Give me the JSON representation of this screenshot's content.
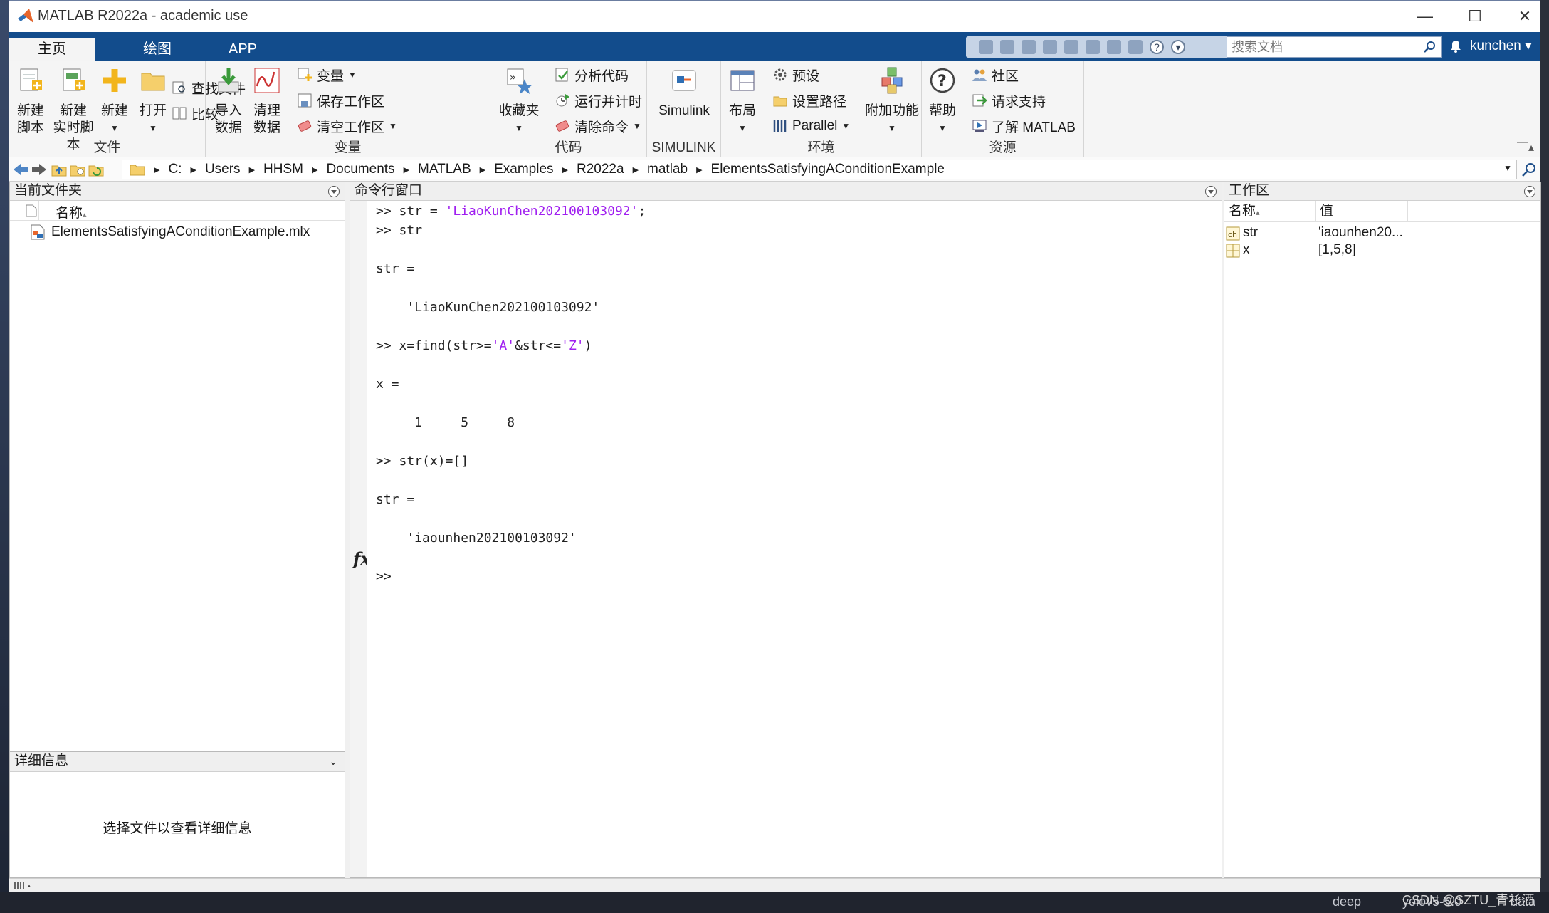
{
  "window": {
    "title": "MATLAB R2022a - academic use",
    "controls": {
      "minimize": "—",
      "maximize": "☐",
      "close": "✕"
    }
  },
  "ribbon_tabs": [
    {
      "label": "主页",
      "active": true
    },
    {
      "label": "绘图",
      "active": false
    },
    {
      "label": "APP",
      "active": false
    }
  ],
  "search": {
    "placeholder": "搜索文档",
    "value": ""
  },
  "user": {
    "name": "kunchen",
    "menu_caret": "▾"
  },
  "ribbon": {
    "file_group": {
      "label": "文件",
      "new_script": [
        "新建",
        "脚本"
      ],
      "new_live_script": [
        "新建",
        "实时脚本"
      ],
      "new": "新建",
      "open": "打开",
      "find_files": "查找文件",
      "compare": "比较"
    },
    "variable_group": {
      "label": "变量",
      "import_data": [
        "导入",
        "数据"
      ],
      "clean_data": [
        "清理",
        "数据"
      ],
      "variable": "变量",
      "save_workspace": "保存工作区",
      "clear_workspace": "清空工作区"
    },
    "code_group": {
      "label": "代码",
      "favorites": "收藏夹",
      "analyze_code": "分析代码",
      "run_and_time": "运行并计时",
      "clear_commands": "清除命令"
    },
    "simulink_group": {
      "label": "SIMULINK",
      "simulink": "Simulink"
    },
    "environment_group": {
      "label": "环境",
      "layout": "布局",
      "preferences": "预设",
      "set_path": "设置路径",
      "parallel": "Parallel",
      "addons": "附加功能"
    },
    "resources_group": {
      "label": "资源",
      "help": "帮助",
      "community": "社区",
      "request_support": "请求支持",
      "learn_matlab": "了解 MATLAB"
    }
  },
  "path": {
    "segments": [
      "C:",
      "Users",
      "HHSM",
      "Documents",
      "MATLAB",
      "Examples",
      "R2022a",
      "matlab",
      "ElementsSatisfyingAConditionExample"
    ]
  },
  "current_folder": {
    "title": "当前文件夹",
    "column_name": "名称",
    "sort_indicator": "▴",
    "files": [
      {
        "name": "ElementsSatisfyingAConditionExample.mlx"
      }
    ]
  },
  "details": {
    "title": "详细信息",
    "message": "选择文件以查看详细信息"
  },
  "command_window": {
    "title": "命令行窗口",
    "lines": [
      {
        "prompt": ">> ",
        "text": "str = ",
        "string": "'LiaoKunChen202100103092'",
        "tail": ";"
      },
      {
        "prompt": ">> ",
        "text": "str",
        "string": "",
        "tail": ""
      },
      {
        "prompt": "",
        "text": "str =",
        "string": "",
        "tail": ""
      },
      {
        "prompt": "",
        "text": "    'LiaoKunChen202100103092'",
        "string": "",
        "tail": ""
      },
      {
        "prompt": ">> ",
        "text": "x=find(str>=",
        "string": "'A'",
        "tail": "&str<='Z')"
      },
      {
        "prompt": "",
        "text": "x =",
        "string": "",
        "tail": ""
      },
      {
        "prompt": "",
        "text": "     1     5     8",
        "string": "",
        "tail": ""
      },
      {
        "prompt": ">> ",
        "text": "str(x)=[]",
        "string": "",
        "tail": ""
      },
      {
        "prompt": "",
        "text": "str =",
        "string": "",
        "tail": ""
      },
      {
        "prompt": "",
        "text": "    'iaounhen202100103092'",
        "string": "",
        "tail": ""
      },
      {
        "prompt": ">> ",
        "text": "",
        "string": "",
        "tail": ""
      }
    ],
    "fx_label": "fx"
  },
  "workspace": {
    "title": "工作区",
    "col_name": "名称",
    "col_value": "值",
    "sort_indicator": "▴",
    "variables": [
      {
        "name": "str",
        "value": "'iaounhen20...",
        "icon": "char-variable-icon"
      },
      {
        "name": "x",
        "value": "[1,5,8]",
        "icon": "matrix-variable-icon"
      }
    ]
  },
  "taskbar": {
    "items": [
      "deep",
      "yolov5-5.0",
      "data"
    ],
    "watermark": "CSDN @SZTU_青衫酒"
  },
  "colors": {
    "tab_bar": "#124c8c",
    "string_literal": "#a020f0",
    "panel_bg": "#ffffff",
    "ribbon_bg": "#f5f5f5"
  }
}
